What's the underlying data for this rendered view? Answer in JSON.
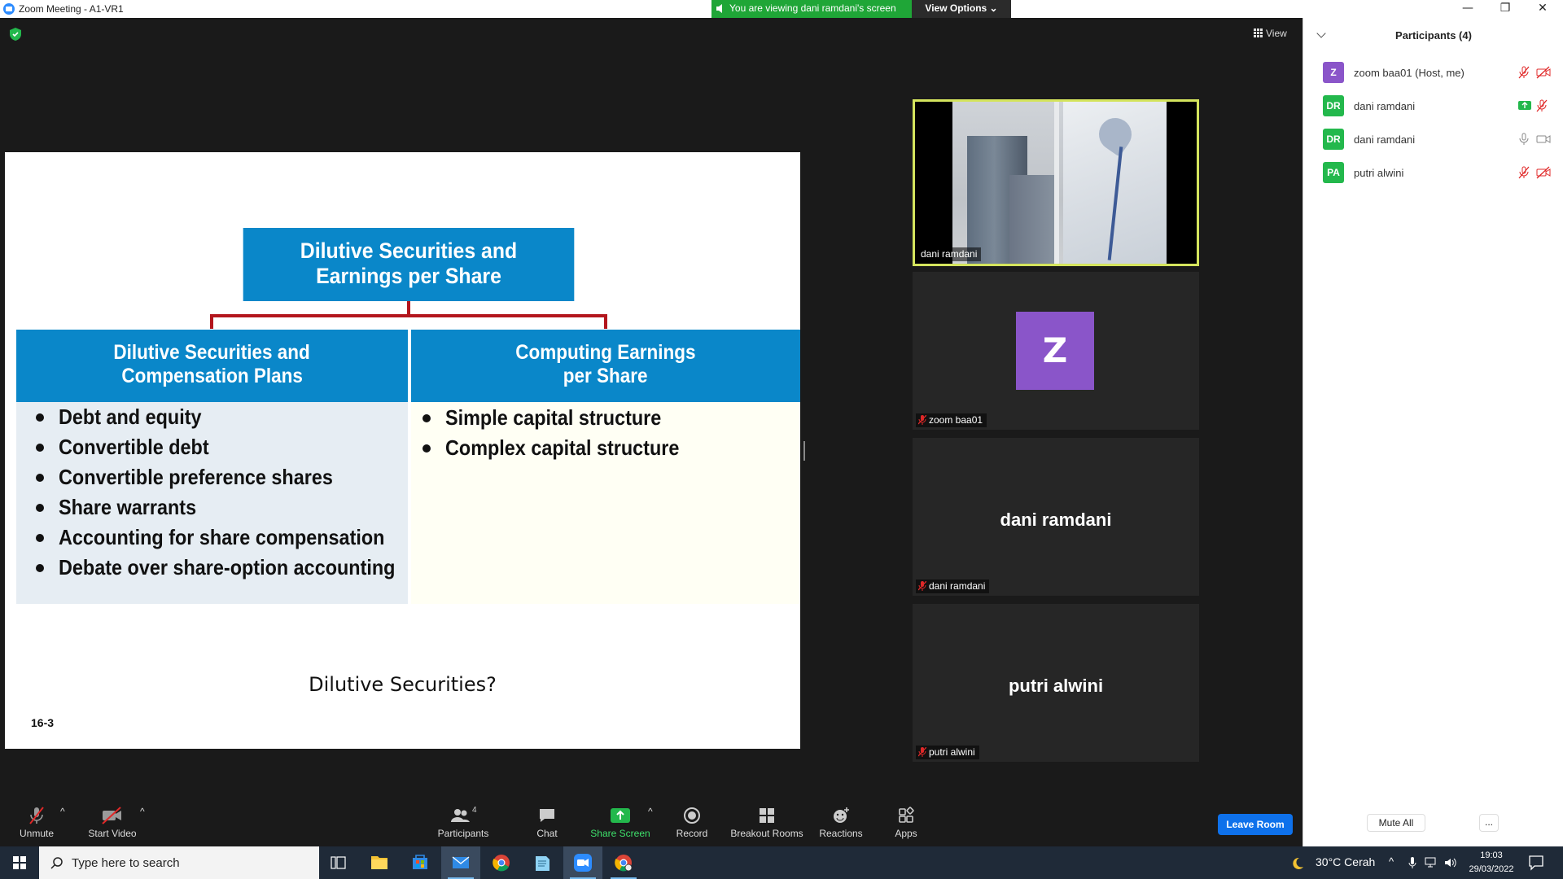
{
  "window": {
    "title": "Zoom Meeting - A1-VR1",
    "minimize": "—",
    "restore": "❐",
    "close": "✕"
  },
  "banner": {
    "viewing_text": "You are viewing dani ramdani's screen",
    "view_options": "View Options ⌄"
  },
  "main": {
    "view_label": "View"
  },
  "slide": {
    "top_box_line1": "Dilutive Securities and",
    "top_box_line2": "Earnings per Share",
    "left_head_line1": "Dilutive Securities and",
    "left_head_line2": "Compensation Plans",
    "right_head_line1": "Computing Earnings",
    "right_head_line2": "per Share",
    "left_items": [
      "Debt and equity",
      "Convertible debt",
      "Convertible preference shares",
      "Share warrants",
      "Accounting for share compensation",
      "Debate over share-option accounting"
    ],
    "right_items": [
      "Simple capital structure",
      "Complex capital structure"
    ],
    "question": "Dilutive Securities?",
    "slide_number": "16-3"
  },
  "tiles": [
    {
      "label": "dani ramdani"
    },
    {
      "label": "zoom baa01",
      "avatar": "Z"
    },
    {
      "label": "dani ramdani",
      "center_name": "dani ramdani"
    },
    {
      "label": "putri alwini",
      "center_name": "putri alwini"
    }
  ],
  "participants": {
    "title": "Participants (4)",
    "list": [
      {
        "initials": "Z",
        "name": "zoom baa01 (Host, me)",
        "color": "#8a55c9",
        "mic": "mic-muted-icon",
        "video": "video-off-icon"
      },
      {
        "initials": "DR",
        "name": "dani ramdani",
        "color": "#23b84c",
        "mic": "share-screen-icon",
        "video": "mic-muted-icon"
      },
      {
        "initials": "DR",
        "name": "dani ramdani",
        "color": "#23b84c",
        "mic": "mic-icon",
        "video": "video-icon"
      },
      {
        "initials": "PA",
        "name": "putri alwini",
        "color": "#23b84c",
        "mic": "mic-muted-icon",
        "video": "video-off-icon"
      }
    ],
    "mute_all": "Mute All",
    "more": "..."
  },
  "toolbar": {
    "unmute": "Unmute",
    "start_video": "Start Video",
    "participants": "Participants",
    "participants_count": "4",
    "chat": "Chat",
    "share_screen": "Share Screen",
    "record": "Record",
    "breakout_rooms": "Breakout Rooms",
    "reactions": "Reactions",
    "apps": "Apps",
    "leave": "Leave Room"
  },
  "taskbar": {
    "search_placeholder": "Type here to search",
    "weather": "30°C  Cerah",
    "time": "19:03",
    "date": "29/03/2022"
  },
  "colors": {
    "zoom_blue": "#0e71eb",
    "slide_blue": "#0a87c9",
    "connector_red": "#b3161d",
    "active_border": "#d4e45d",
    "banner_green": "#1fa637"
  }
}
